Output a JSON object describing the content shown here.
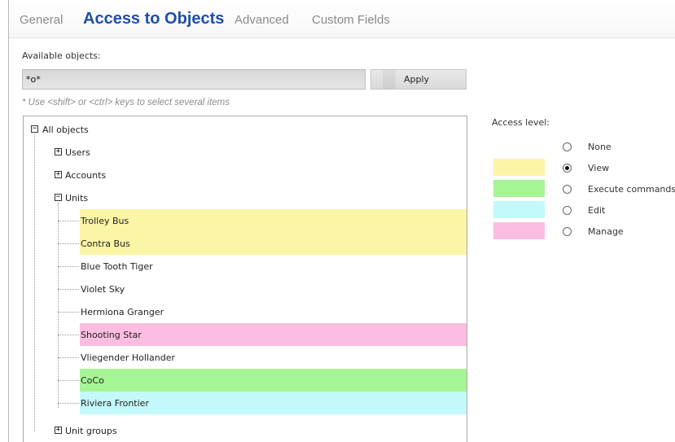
{
  "tabs": [
    {
      "label": "General",
      "active": false
    },
    {
      "label": "Access to Objects",
      "active": true
    },
    {
      "label": "Advanced",
      "active": false
    },
    {
      "label": "Custom Fields",
      "active": false
    }
  ],
  "filter": {
    "label": "Available objects:",
    "value": "*o*",
    "apply_label": "Apply",
    "hint": "* Use <shift> or <ctrl> keys to select several items"
  },
  "tree": {
    "root": {
      "label": "All objects",
      "expanded": true
    },
    "groups": [
      {
        "label": "Users",
        "expanded": false
      },
      {
        "label": "Accounts",
        "expanded": false
      },
      {
        "label": "Units",
        "expanded": true
      },
      {
        "label": "Unit groups",
        "expanded": false
      }
    ],
    "units": [
      {
        "label": "Trolley Bus",
        "access": "view"
      },
      {
        "label": "Contra Bus",
        "access": "view"
      },
      {
        "label": "Blue Tooth Tiger",
        "access": "none"
      },
      {
        "label": "Violet Sky",
        "access": "none"
      },
      {
        "label": "Hermiona Granger",
        "access": "none"
      },
      {
        "label": "Shooting Star",
        "access": "manage"
      },
      {
        "label": "Vliegender Hollander",
        "access": "none"
      },
      {
        "label": "CoCo",
        "access": "execute"
      },
      {
        "label": "Riviera Frontier",
        "access": "edit"
      }
    ]
  },
  "access": {
    "label": "Access level:",
    "selected": "view",
    "levels": [
      {
        "key": "none",
        "label": "None",
        "color": ""
      },
      {
        "key": "view",
        "label": "View",
        "color": "#fbf5a6"
      },
      {
        "key": "execute",
        "label": "Execute commands",
        "color": "#a6f595"
      },
      {
        "key": "edit",
        "label": "Edit",
        "color": "#c4f9fb"
      },
      {
        "key": "manage",
        "label": "Manage",
        "color": "#fbbde1"
      }
    ]
  },
  "icons": {
    "expand": "plus-box-icon",
    "collapse": "minus-box-icon"
  }
}
